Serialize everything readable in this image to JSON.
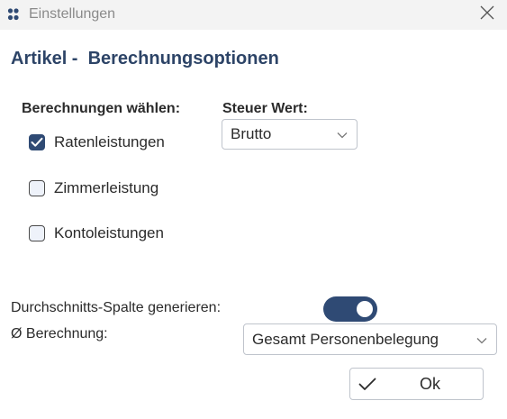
{
  "window": {
    "title": "Einstellungen",
    "icon": "app-logo-icon",
    "close_icon": "close-icon"
  },
  "heading": "Artikel -  Berechnungsoptionen",
  "calculations": {
    "label": "Berechnungen wählen:",
    "options": [
      {
        "label": "Ratenleistungen",
        "checked": true
      },
      {
        "label": "Zimmerleistung",
        "checked": false
      },
      {
        "label": "Kontoleistungen",
        "checked": false
      }
    ]
  },
  "tax": {
    "label": "Steuer Wert:",
    "selected": "Brutto"
  },
  "average": {
    "label": "Durchschnitts-Spalte generieren:",
    "enabled": true
  },
  "calc_basis": {
    "label": "Ø Berechnung:",
    "selected": "Gesamt Personenbelegung"
  },
  "ok_button": {
    "label": "Ok",
    "icon": "checkmark-icon"
  },
  "colors": {
    "accent": "#2f4a74",
    "heading": "#2d4467",
    "titlebar": "#f3f3f3"
  }
}
